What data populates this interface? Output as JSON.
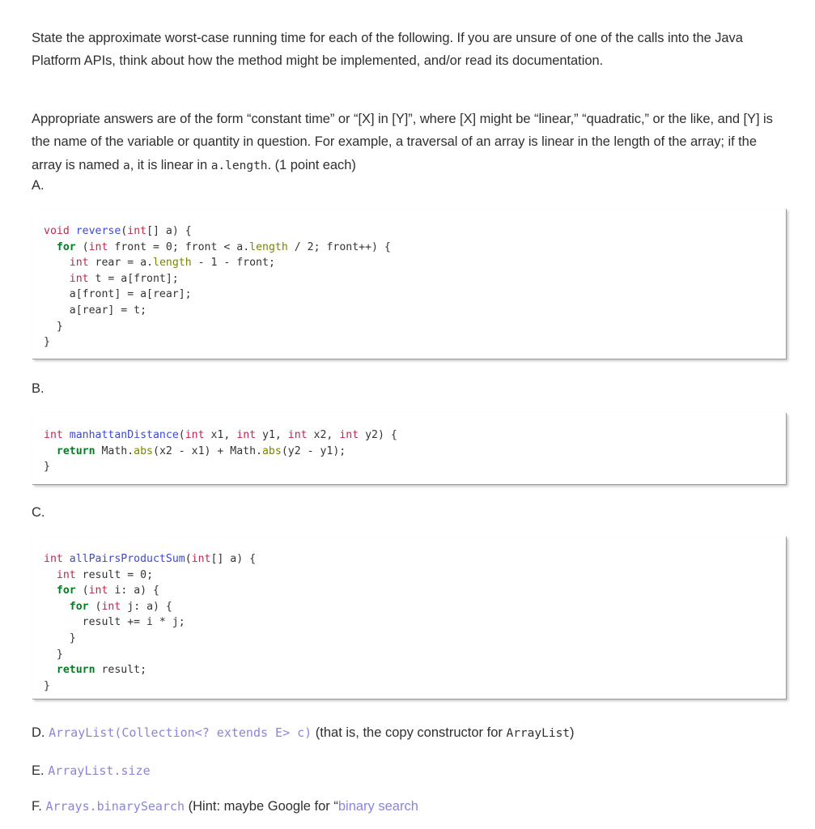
{
  "document": {
    "paragraphs": {
      "intro": "State the approximate worst-case running time for each of the following. If you are unsure of one of the calls into the Java Platform APIs, think about how the method might be implemented, and/or read its documentation.",
      "form_part1": "Appropriate answers are of the form “constant time” or “[X] in [Y]”, where [X] might be “linear,” “quadratic,” or the like, and [Y] is the name of the variable or quantity in question. For example, a traversal of an array is linear in the length of the array; if the array is named ",
      "form_code_a": "a",
      "form_part2": ", it is linear in ",
      "form_code_alength": "a.length",
      "form_part3": ". (1 point each)"
    },
    "sections": [
      {
        "letter": "A."
      },
      {
        "letter": "B."
      },
      {
        "letter": "C."
      }
    ],
    "code_blocks": {
      "a": {
        "lines": [
          "void reverse(int[] a) {",
          "  for (int front = 0; front < a.length / 2; front++) {",
          "    int rear = a.length - 1 - front;",
          "    int t = a[front];",
          "    a[front] = a[rear];",
          "    a[rear] = t;",
          "  }",
          "}"
        ]
      },
      "b": {
        "lines": [
          "int manhattanDistance(int x1, int y1, int x2, int y2) {",
          "  return Math.abs(x2 - x1) + Math.abs(y2 - y1);",
          "}"
        ]
      },
      "c": {
        "lines": [
          "int allPairsProductSum(int[] a) {",
          "  int result = 0;",
          "  for (int i: a) {",
          "    for (int j: a) {",
          "      result += i * j;",
          "    }",
          "  }",
          "  return result;",
          "}"
        ]
      }
    },
    "items": {
      "d": {
        "letter": "D.",
        "code": "ArrayList(Collection<? extends E> c)",
        "text": " (that is, the copy constructor for ",
        "code_tail": "ArrayList",
        "text_tail": ")"
      },
      "e": {
        "letter": "E.",
        "code": "ArrayList.size"
      },
      "f": {
        "letter": "F.",
        "code": "Arrays.binarySearch",
        "text": " (Hint: maybe Google for “",
        "link": "binary search"
      }
    },
    "colors": {
      "text": "#2f2f2f",
      "keyword": "#007f20",
      "type": "#c4264a",
      "function": "#3b49d6",
      "member": "#7a8400",
      "code_ref": "#8a86d8",
      "link": "#8a86d8",
      "block_border": "#9a9a9a"
    }
  }
}
